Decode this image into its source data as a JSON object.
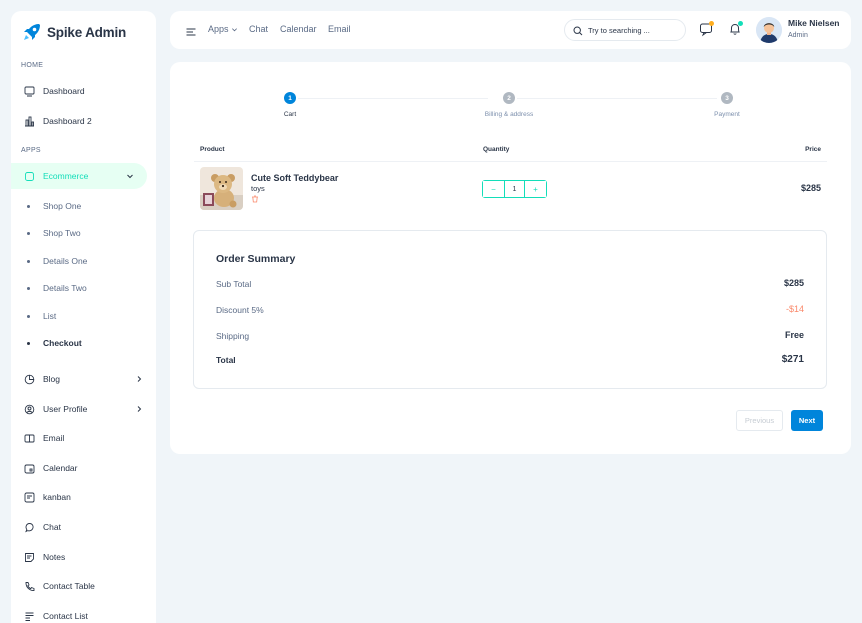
{
  "brand": {
    "name": "Spike Admin",
    "accent": "#0085db"
  },
  "sidebar": {
    "caption_home": "HOME",
    "caption_apps": "APPS",
    "home_items": [
      {
        "label": "Dashboard",
        "icon": "monitor-icon"
      },
      {
        "label": "Dashboard 2",
        "icon": "chart-bar-icon"
      }
    ],
    "ecommerce": {
      "label": "Ecommerce",
      "icon": "basket-icon",
      "expanded": true
    },
    "ecommerce_sub": [
      "Shop One",
      "Shop Two",
      "Details One",
      "Details Two",
      "List",
      "Checkout"
    ],
    "current_sub": "Checkout",
    "apps_items": [
      {
        "label": "Blog",
        "icon": "chart-pie-icon",
        "has_children": true
      },
      {
        "label": "User Profile",
        "icon": "user-circle-icon",
        "has_children": true
      },
      {
        "label": "Email",
        "icon": "mail-icon"
      },
      {
        "label": "Calendar",
        "icon": "calendar-icon"
      },
      {
        "label": "kanban",
        "icon": "layout-kanban-icon"
      },
      {
        "label": "Chat",
        "icon": "message-icon"
      },
      {
        "label": "Notes",
        "icon": "notes-icon"
      },
      {
        "label": "Contact Table",
        "icon": "phone-icon"
      },
      {
        "label": "Contact List",
        "icon": "list-details-icon"
      }
    ]
  },
  "header": {
    "menu_apps": "Apps",
    "menu_chat": "Chat",
    "menu_calendar": "Calendar",
    "menu_email": "Email",
    "search_placeholder": "Try to searching ...",
    "user_name": "Mike Nielsen",
    "user_role": "Admin"
  },
  "checkout": {
    "steps": [
      {
        "number": "1",
        "label": "Cart",
        "active": true
      },
      {
        "number": "2",
        "label": "Billing & address",
        "active": false
      },
      {
        "number": "3",
        "label": "Payment",
        "active": false
      }
    ],
    "columns": {
      "product": "Product",
      "quantity": "Quantity",
      "price": "Price"
    },
    "items": [
      {
        "name": "Cute Soft Teddybear",
        "category": "toys",
        "quantity": "1",
        "price": "$285"
      }
    ],
    "qty_minus": "−",
    "qty_plus": "+",
    "summary": {
      "title": "Order Summary",
      "subtotal_label": "Sub Total",
      "subtotal_value": "$285",
      "discount_label": "Discount 5%",
      "discount_value": "-$14",
      "shipping_label": "Shipping",
      "shipping_value": "Free",
      "total_label": "Total",
      "total_value": "$271"
    },
    "previous_label": "Previous",
    "next_label": "Next"
  }
}
